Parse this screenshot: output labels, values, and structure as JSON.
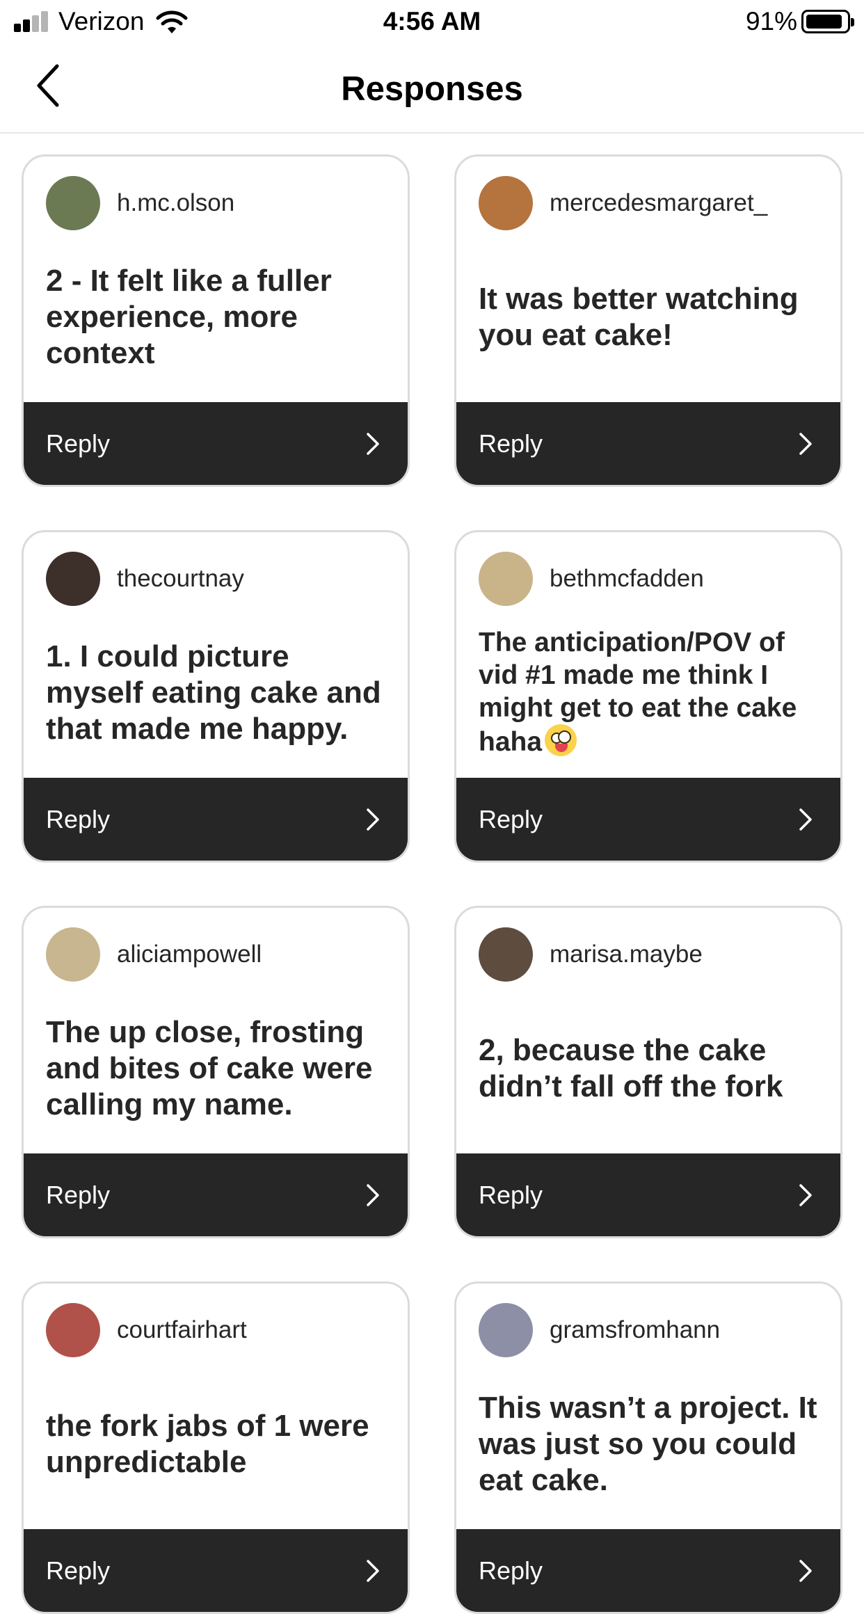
{
  "status_bar": {
    "carrier": "Verizon",
    "time": "4:56 AM",
    "battery_percent": "91%",
    "battery_level": 0.91,
    "signal_bars": 2
  },
  "nav": {
    "title": "Responses",
    "back_icon": "chevron-left-icon"
  },
  "colors": {
    "reply_bar": "#262626",
    "card_border": "#dbdbdb",
    "text": "#262626"
  },
  "responses": [
    {
      "username": "h.mc.olson",
      "text": "2 - It felt like a fuller experience, more context",
      "reply_label": "Reply",
      "avatar_color": "#6b7a52"
    },
    {
      "username": "mercedesmargaret_",
      "text": "It was better watching you eat cake!",
      "reply_label": "Reply",
      "avatar_color": "#b5733d"
    },
    {
      "username": "thecourtnay",
      "text": "1. I could picture myself eating cake and that made me happy.",
      "reply_label": "Reply",
      "avatar_color": "#3d2f2a"
    },
    {
      "username": "bethmcfadden",
      "text": "The anticipation/POV of vid #1 made me think I might get to eat the cake haha",
      "emoji": "zany-face-emoji",
      "reply_label": "Reply",
      "avatar_color": "#c9b48a"
    },
    {
      "username": "aliciampowell",
      "text": "The up close, frosting and bites of cake were calling my name.",
      "reply_label": "Reply",
      "avatar_color": "#c8b690"
    },
    {
      "username": "marisa.maybe",
      "text": "2, because the cake didn’t fall off the fork",
      "reply_label": "Reply",
      "avatar_color": "#5e4c3f"
    },
    {
      "username": "courtfairhart",
      "text": "the fork jabs of 1 were unpredictable",
      "reply_label": "Reply",
      "avatar_color": "#b0524a"
    },
    {
      "username": "gramsfromhann",
      "text": "This wasn’t a project. It was just so you could eat cake.",
      "reply_label": "Reply",
      "avatar_color": "#8d8fa6"
    }
  ]
}
